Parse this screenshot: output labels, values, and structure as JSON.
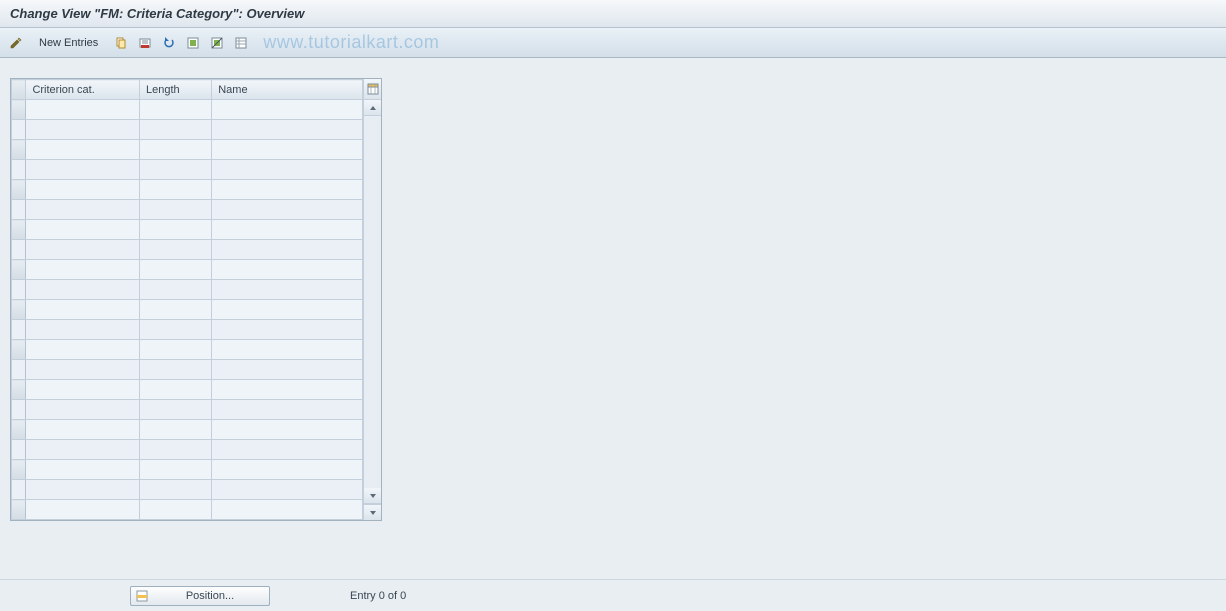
{
  "title": "Change View \"FM: Criteria Category\": Overview",
  "toolbar": {
    "new_entries_label": "New Entries"
  },
  "watermark": "www.tutorialkart.com",
  "table": {
    "columns": [
      "Criterion cat.",
      "Length",
      "Name"
    ],
    "row_count": 21,
    "rows": [
      [
        "",
        "",
        ""
      ],
      [
        "",
        "",
        ""
      ],
      [
        "",
        "",
        ""
      ],
      [
        "",
        "",
        ""
      ],
      [
        "",
        "",
        ""
      ],
      [
        "",
        "",
        ""
      ],
      [
        "",
        "",
        ""
      ],
      [
        "",
        "",
        ""
      ],
      [
        "",
        "",
        ""
      ],
      [
        "",
        "",
        ""
      ],
      [
        "",
        "",
        ""
      ],
      [
        "",
        "",
        ""
      ],
      [
        "",
        "",
        ""
      ],
      [
        "",
        "",
        ""
      ],
      [
        "",
        "",
        ""
      ],
      [
        "",
        "",
        ""
      ],
      [
        "",
        "",
        ""
      ],
      [
        "",
        "",
        ""
      ],
      [
        "",
        "",
        ""
      ],
      [
        "",
        "",
        ""
      ],
      [
        "",
        "",
        ""
      ]
    ]
  },
  "footer": {
    "position_label": "Position...",
    "entry_text": "Entry 0 of 0"
  }
}
